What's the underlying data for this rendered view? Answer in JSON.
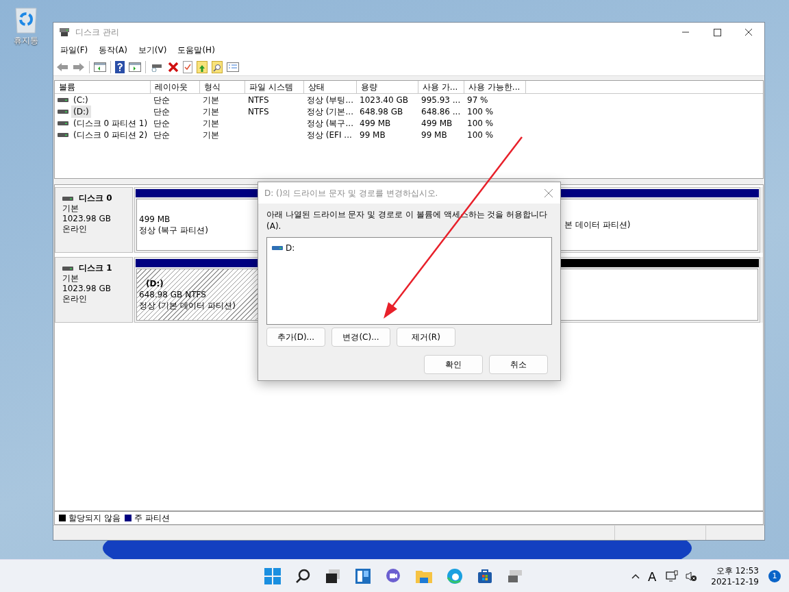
{
  "desktop": {
    "icons": [
      {
        "label": "휴지통"
      }
    ]
  },
  "window": {
    "title": "디스크 관리",
    "menu": [
      "파일(F)",
      "동작(A)",
      "보기(V)",
      "도움말(H)"
    ],
    "volume_table": {
      "columns": [
        "볼륨",
        "레이아웃",
        "형식",
        "파일 시스템",
        "상태",
        "용량",
        "사용 가...",
        "사용 가능한..."
      ],
      "rows": [
        {
          "selected": false,
          "cells": [
            "(C:)",
            "단순",
            "기본",
            "NTFS",
            "정상 (부팅...",
            "1023.40 GB",
            "995.93 ...",
            "97 %"
          ]
        },
        {
          "selected": true,
          "cells": [
            "(D:)",
            "단순",
            "기본",
            "NTFS",
            "정상 (기본...",
            "648.98 GB",
            "648.86 ...",
            "100 %"
          ]
        },
        {
          "selected": false,
          "cells": [
            "(디스크 0 파티션 1)",
            "단순",
            "기본",
            "",
            "정상 (복구...",
            "499 MB",
            "499 MB",
            "100 %"
          ]
        },
        {
          "selected": false,
          "cells": [
            "(디스크 0 파티션 2)",
            "단순",
            "기본",
            "",
            "정상 (EFI ...",
            "99 MB",
            "99 MB",
            "100 %"
          ]
        }
      ]
    },
    "disks": [
      {
        "name": "디스크 0",
        "type": "기본",
        "size": "1023.98 GB",
        "status": "온라인",
        "partitions": [
          {
            "kind": "primary",
            "selected": false,
            "lines": [
              "499 MB",
              "정상 (복구 파티션)"
            ]
          },
          {
            "kind": "primary",
            "selected": false,
            "lines": [
              "본 데이터 파티션)"
            ]
          }
        ]
      },
      {
        "name": "디스크 1",
        "type": "기본",
        "size": "1023.98 GB",
        "status": "온라인",
        "partitions": [
          {
            "kind": "primary",
            "selected": true,
            "label": "(D:)",
            "lines": [
              "648.98 GB NTFS",
              "정상 (기본 데이터 파티션)"
            ]
          },
          {
            "kind": "unallocated",
            "selected": false
          }
        ]
      }
    ],
    "legend": [
      {
        "label": "할당되지 않음",
        "color": "#000000"
      },
      {
        "label": "주 파티션",
        "color": "#000080"
      }
    ]
  },
  "dialog": {
    "title": "D: ()의 드라이브 문자 및 경로를 변경하십시오.",
    "message": "아래 나열된 드라이브 문자 및 경로로 이 볼륨에 액세스하는 것을 허용합니다(A).",
    "paths": [
      {
        "label": "D:",
        "selected": false
      }
    ],
    "buttons": [
      "추가(D)...",
      "변경(C)...",
      "제거(R)"
    ],
    "footer_buttons": [
      "확인",
      "취소"
    ]
  },
  "taskbar": {
    "ime": "A",
    "time": "오후 12:53",
    "date": "2021-12-19",
    "notifications": "1"
  }
}
